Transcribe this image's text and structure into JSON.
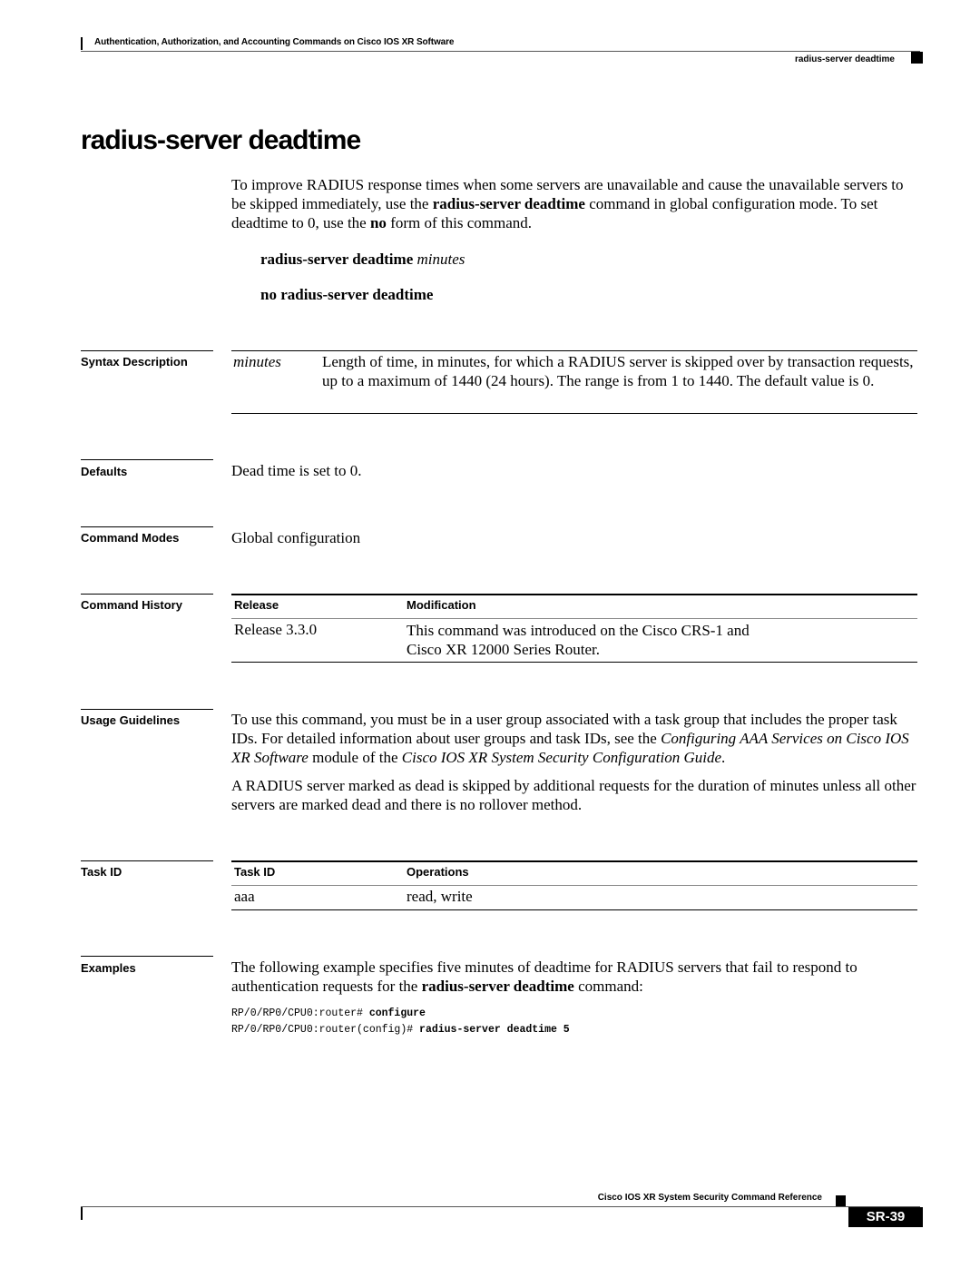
{
  "header": {
    "chapter_title": "Authentication, Authorization, and Accounting Commands on Cisco IOS XR Software",
    "running_head": "radius-server deadtime"
  },
  "page_title": "radius-server deadtime",
  "intro": {
    "part1": "To improve RADIUS response times when some servers are unavailable and cause the unavailable servers to be skipped immediately, use the ",
    "bold1": "radius-server deadtime",
    "part2": " command in global configuration mode. To set deadtime to 0, use the ",
    "bold2": "no",
    "part3": " form of this command."
  },
  "syntax": {
    "command": "radius-server deadtime",
    "argument": "minutes",
    "no_form": "no radius-server deadtime"
  },
  "sections": {
    "syntax_description": {
      "label": "Syntax Description",
      "rows": [
        {
          "term": "minutes",
          "description": "Length of time, in minutes, for which a RADIUS server is skipped over by transaction requests, up to a maximum of 1440 (24 hours). The range is from 1 to 1440. The default value is 0."
        }
      ]
    },
    "defaults": {
      "label": "Defaults",
      "text": "Dead time is set to 0."
    },
    "command_modes": {
      "label": "Command Modes",
      "text": "Global configuration"
    },
    "command_history": {
      "label": "Command History",
      "columns": [
        "Release",
        "Modification"
      ],
      "rows": [
        {
          "release": "Release 3.3.0",
          "modification_line1": "This command was introduced on the Cisco CRS-1 and",
          "modification_line2": "Cisco XR 12000 Series Router."
        }
      ]
    },
    "usage_guidelines": {
      "label": "Usage Guidelines",
      "p1_part1": "To use this command, you must be in a user group associated with a task group that includes the proper task IDs. For detailed information about user groups and task IDs, see the ",
      "p1_italic1": "Configuring AAA Services on Cisco IOS XR Software",
      "p1_part2": " module of the ",
      "p1_italic2": "Cisco IOS XR System Security Configuration Guide",
      "p1_part3": ".",
      "p2": "A RADIUS server marked as dead is skipped by additional requests for the duration of minutes unless all other servers are marked dead and there is no rollover method."
    },
    "task_id": {
      "label": "Task ID",
      "columns": [
        "Task ID",
        "Operations"
      ],
      "rows": [
        {
          "task_id": "aaa",
          "operations": "read, write"
        }
      ]
    },
    "examples": {
      "label": "Examples",
      "part1": "The following example specifies five minutes of deadtime for RADIUS servers that fail to respond to authentication requests for the ",
      "bold1": "radius-server deadtime",
      "part2": " command:",
      "code": [
        {
          "prompt": "RP/0/RP0/CPU0:router# ",
          "command": "configure"
        },
        {
          "prompt": "RP/0/RP0/CPU0:router(config)# ",
          "command": "radius-server deadtime 5"
        }
      ]
    }
  },
  "footer": {
    "book_title": "Cisco IOS XR System Security Command Reference",
    "page_number": "SR-39"
  }
}
